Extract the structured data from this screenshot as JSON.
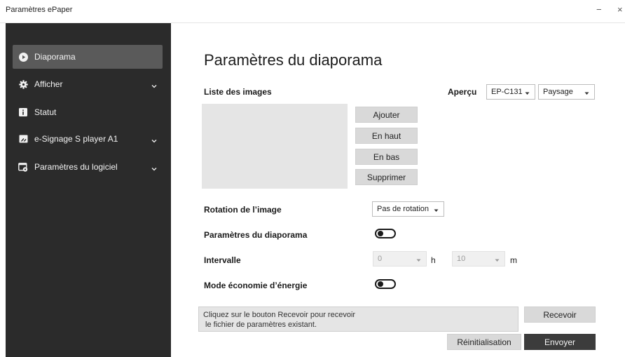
{
  "window": {
    "title": "Paramètres ePaper",
    "minimize": "−",
    "close": "×"
  },
  "sidebar": {
    "items": [
      {
        "label": "Diaporama",
        "icon": "play-icon",
        "active": true
      },
      {
        "label": "Afficher",
        "icon": "gear-icon",
        "expandable": true
      },
      {
        "label": "Statut",
        "icon": "info-icon"
      },
      {
        "label": "e-Signage S player A1",
        "icon": "device-icon",
        "expandable": true
      },
      {
        "label": "Paramètres du logiciel",
        "icon": "software-settings-icon",
        "expandable": true
      }
    ]
  },
  "main": {
    "heading": "Paramètres du diaporama",
    "image_list_label": "Liste des images",
    "preview_label": "Aperçu",
    "preview_model": "EP-C131",
    "preview_orientation": "Paysage",
    "buttons": {
      "add": "Ajouter",
      "up": "En haut",
      "down": "En bas",
      "delete": "Supprimer",
      "receive": "Recevoir",
      "reset": "Réinitialisation",
      "send": "Envoyer"
    },
    "rotation_label": "Rotation de l’image",
    "rotation_value": "Pas de rotation",
    "slideshow_settings_label": "Paramètres du diaporama",
    "slideshow_enabled": false,
    "interval_label": "Intervalle",
    "interval_hours": "0",
    "interval_hours_unit": "h",
    "interval_minutes": "10",
    "interval_minutes_unit": "m",
    "power_saving_label": "Mode économie d’énergie",
    "power_saving_enabled": false,
    "message_line1": "Cliquez sur le bouton Recevoir pour recevoir",
    "message_line2": " le fichier de paramètres existant."
  },
  "colors": {
    "sidebar_bg": "#2b2b2b",
    "sidebar_active": "#5a5a5a",
    "button_dark": "#3c3c3c",
    "button_light": "#d9d9d9"
  }
}
